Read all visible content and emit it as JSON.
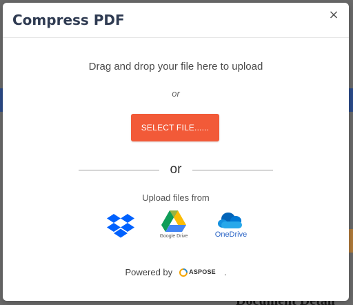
{
  "modal": {
    "title": "Compress PDF",
    "close_symbol": "×",
    "drag_drop_text": "Drag and drop your file here to upload",
    "or_small": "or",
    "select_file_label": "SELECT FILE......",
    "or_big": "or",
    "upload_from_text": "Upload files from",
    "providers": [
      {
        "name": "Dropbox",
        "icon": "dropbox-icon"
      },
      {
        "name": "Google Drive",
        "label": "Google Drive",
        "icon": "google-drive-icon"
      },
      {
        "name": "OneDrive",
        "label": "OneDrive",
        "icon": "onedrive-icon"
      }
    ],
    "powered_by": "Powered by",
    "brand": "ASPOSE",
    "brand_dot": "."
  },
  "background": {
    "bottom_text": "Document Detail"
  },
  "colors": {
    "accent": "#f25a38",
    "title": "#2f3b52",
    "dropbox": "#0061fe",
    "onedrive": "#0364b8"
  }
}
